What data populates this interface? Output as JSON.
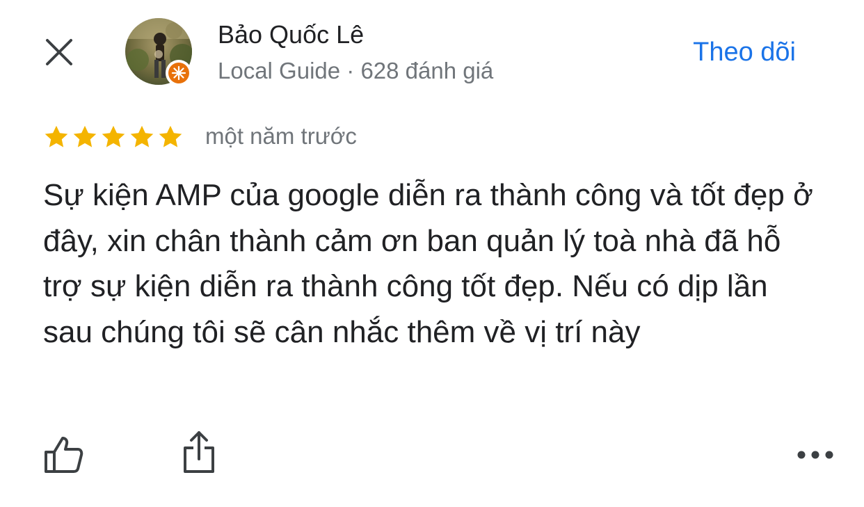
{
  "header": {
    "close_icon": "close-icon",
    "user": {
      "name": "Bảo Quốc Lê",
      "meta": "Local Guide · 628 đánh giá",
      "badge_icon": "local-guide-badge-icon"
    },
    "follow_label": "Theo dõi"
  },
  "review": {
    "rating": 5,
    "rating_max": 5,
    "time_ago": "một năm trước",
    "text": "Sự kiện AMP của google diễn ra thành công và tốt đẹp ở đây, xin chân thành cảm ơn ban quản lý toà nhà đã hỗ trợ sự kiện diễn ra thành công tốt đẹp. Nếu có dịp lần sau chúng tôi sẽ cân nhắc thêm về vị trí này"
  },
  "actions": {
    "like_icon": "thumbs-up-icon",
    "share_icon": "share-icon",
    "more_icon": "more-horizontal-icon"
  },
  "colors": {
    "accent": "#1a73e8",
    "star": "#f4b400",
    "text": "#202124",
    "secondary_text": "#70757a",
    "badge": "#e8710a"
  }
}
